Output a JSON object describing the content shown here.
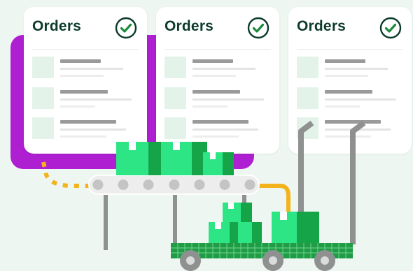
{
  "cards": [
    {
      "title": "Orders",
      "check_icon": "check-circle-icon"
    },
    {
      "title": "Orders",
      "check_icon": "check-circle-icon"
    },
    {
      "title": "Orders",
      "check_icon": "check-circle-icon"
    }
  ],
  "colors": {
    "background": "#eef6f2",
    "purple_panel": "#ad1fd1",
    "card": "#ffffff",
    "title": "#0c3b2a",
    "check": "#1a8a3c",
    "box_light": "#2ee585",
    "box_dark": "#15a548",
    "cart_base": "#1f9c45",
    "pole": "#8f9090",
    "conveyor": "#ededed",
    "dash_orange": "#f3b31b"
  },
  "icons": [
    "check-circle-icon",
    "conveyor-belt-icon",
    "package-icon",
    "cart-icon"
  ]
}
